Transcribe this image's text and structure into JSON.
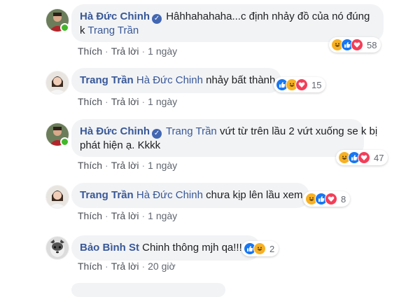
{
  "colors": {
    "link": "#385898",
    "bubble": "#f2f3f5",
    "meta": "#606770",
    "like": "#1877f2",
    "love": "#f33e58",
    "haha": "#f7b125",
    "online": "#42b72a"
  },
  "actions": {
    "like": "Thích",
    "reply": "Trả lời",
    "sep": "·"
  },
  "comments": [
    {
      "author": "Hà Đức Chinh",
      "verified": true,
      "text_line1": "Hâhhahahaha...c định nhảy đồ của nó đúng",
      "text_line2_prefix": "k ",
      "tag": "Trang Trần",
      "time": "1 ngày",
      "reaction_count": "58",
      "reactions": [
        "haha-icon",
        "like-icon",
        "love-icon"
      ]
    },
    {
      "author": "Trang Trần",
      "tag": "Hà Đức Chinh",
      "text": "nhảy bất thành",
      "time": "1 ngày",
      "reaction_count": "15",
      "reactions": [
        "like-icon",
        "haha-icon",
        "love-icon"
      ]
    },
    {
      "author": "Hà Đức Chinh",
      "verified": true,
      "tag": "Trang Trần",
      "text_line1": "vứt từ trên lầu 2 vứt xuống se k bị",
      "text_line2": "phát hiện ạ. Kkkk",
      "time": "1 ngày",
      "reaction_count": "47",
      "reactions": [
        "haha-icon",
        "like-icon",
        "love-icon"
      ]
    },
    {
      "author": "Trang Trần",
      "tag": "Hà Đức Chinh",
      "text": "chưa kịp lên lầu xem .",
      "time": "1 ngày",
      "reaction_count": "8",
      "reactions": [
        "haha-icon",
        "like-icon",
        "love-icon"
      ]
    },
    {
      "author": "Bảo Bình St",
      "text": "Chinh thông mjh qa!!!",
      "time": "20 giờ",
      "reaction_count": "2",
      "reactions": [
        "like-icon",
        "haha-icon"
      ]
    }
  ]
}
